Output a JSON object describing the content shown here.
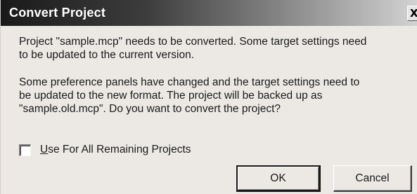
{
  "dialog": {
    "title": "Convert Project",
    "close_glyph": "X",
    "message_1": [
      "Project \"sample.mcp\" needs to be converted. Some target settings need",
      "to be updated to the current version."
    ],
    "message_2": [
      "Some preference panels have changed and the target settings need to",
      "be updated to the new format. The project will be backed up as",
      "\"sample.old.mcp\". Do you want to convert the project?"
    ],
    "checkbox": {
      "label_mnemonic": "U",
      "label_rest": "se For All Remaining Projects",
      "checked": false
    },
    "buttons": {
      "ok_label": "OK",
      "cancel_label": "Cancel"
    }
  },
  "icons": {
    "close": "close-icon"
  }
}
